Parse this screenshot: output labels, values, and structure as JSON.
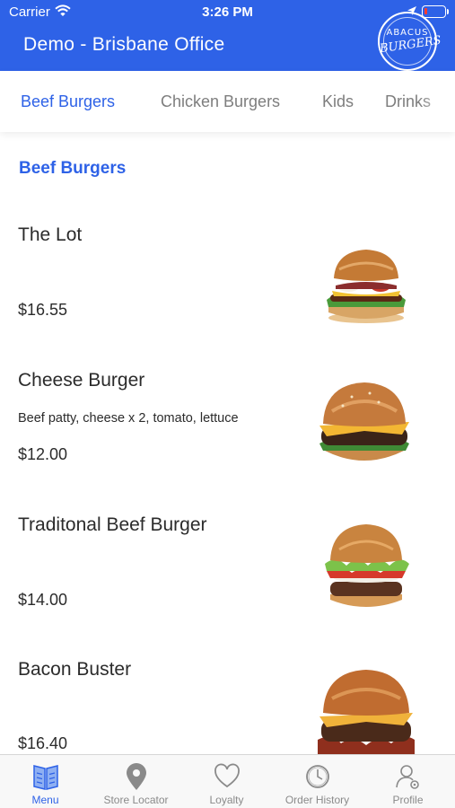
{
  "status_bar": {
    "carrier": "Carrier",
    "time": "3:26 PM"
  },
  "header": {
    "title": "Demo - Brisbane Office",
    "logo_top": "ABACUS",
    "logo_bottom": "BURGERS",
    "bar_color": "#2e62e7"
  },
  "tabs": [
    {
      "label": "Beef Burgers",
      "active": true
    },
    {
      "label": "Chicken Burgers",
      "active": false
    },
    {
      "label": "Kids",
      "active": false
    },
    {
      "label": "Drinks",
      "active": false
    }
  ],
  "section": {
    "title": "Beef Burgers"
  },
  "items": [
    {
      "name": "The Lot",
      "description": "",
      "price": "$16.55",
      "image": "the-lot-burger-photo"
    },
    {
      "name": "Cheese Burger",
      "description": "Beef patty, cheese x 2, tomato, lettuce",
      "price": "$12.00",
      "image": "cheese-burger-photo"
    },
    {
      "name": "Traditonal Beef Burger",
      "description": "",
      "price": "$14.00",
      "image": "traditional-burger-photo"
    },
    {
      "name": "Bacon Buster",
      "description": "",
      "price": "$16.40",
      "image": "bacon-buster-photo"
    }
  ],
  "bottom_nav": [
    {
      "label": "Menu",
      "icon": "menu-book-icon",
      "active": true
    },
    {
      "label": "Store Locator",
      "icon": "map-pin-icon",
      "active": false
    },
    {
      "label": "Loyalty",
      "icon": "heart-icon",
      "active": false
    },
    {
      "label": "Order History",
      "icon": "clock-icon",
      "active": false
    },
    {
      "label": "Profile",
      "icon": "profile-gear-icon",
      "active": false
    }
  ],
  "colors": {
    "accent": "#2e62e7",
    "inactive": "#8a8a8a",
    "battery": "#ff3b30"
  },
  "battery_level": 0.15
}
